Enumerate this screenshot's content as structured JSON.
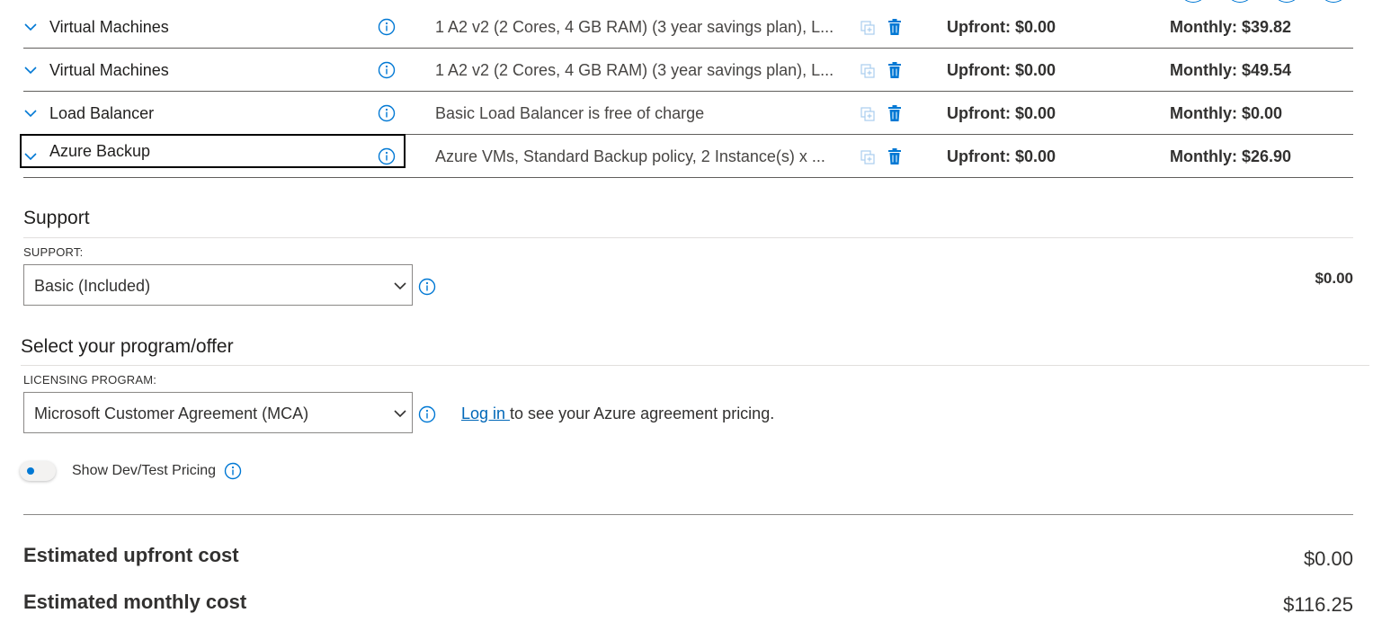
{
  "rows": [
    {
      "name": "Virtual Machines",
      "description": "1 A2 v2 (2 Cores, 4 GB RAM) (3 year savings plan), L...",
      "upfront": "Upfront: $0.00",
      "monthly": "Monthly: $39.82"
    },
    {
      "name": "Virtual Machines",
      "description": "1 A2 v2 (2 Cores, 4 GB RAM) (3 year savings plan), L...",
      "upfront": "Upfront: $0.00",
      "monthly": "Monthly: $49.54"
    },
    {
      "name": "Load Balancer",
      "description": "Basic Load Balancer is free of charge",
      "upfront": "Upfront: $0.00",
      "monthly": "Monthly: $0.00"
    },
    {
      "name": "Azure Backup",
      "description": "Azure VMs, Standard Backup policy, 2 Instance(s) x ...",
      "upfront": "Upfront: $0.00",
      "monthly": "Monthly: $26.90"
    }
  ],
  "support": {
    "title": "Support",
    "label": "SUPPORT:",
    "selected": "Basic (Included)",
    "price": "$0.00"
  },
  "program": {
    "title": "Select your program/offer",
    "label": "LICENSING PROGRAM:",
    "selected": "Microsoft Customer Agreement (MCA)",
    "login_link": "Log in ",
    "login_suffix": "to see your Azure agreement pricing."
  },
  "devtest": {
    "label": "Show Dev/Test Pricing"
  },
  "estimates": {
    "upfront_label": "Estimated upfront cost",
    "upfront_value": "$0.00",
    "monthly_label": "Estimated monthly cost",
    "monthly_value": "$116.25"
  },
  "colors": {
    "accent": "#0078d4",
    "link": "#0067b8"
  }
}
